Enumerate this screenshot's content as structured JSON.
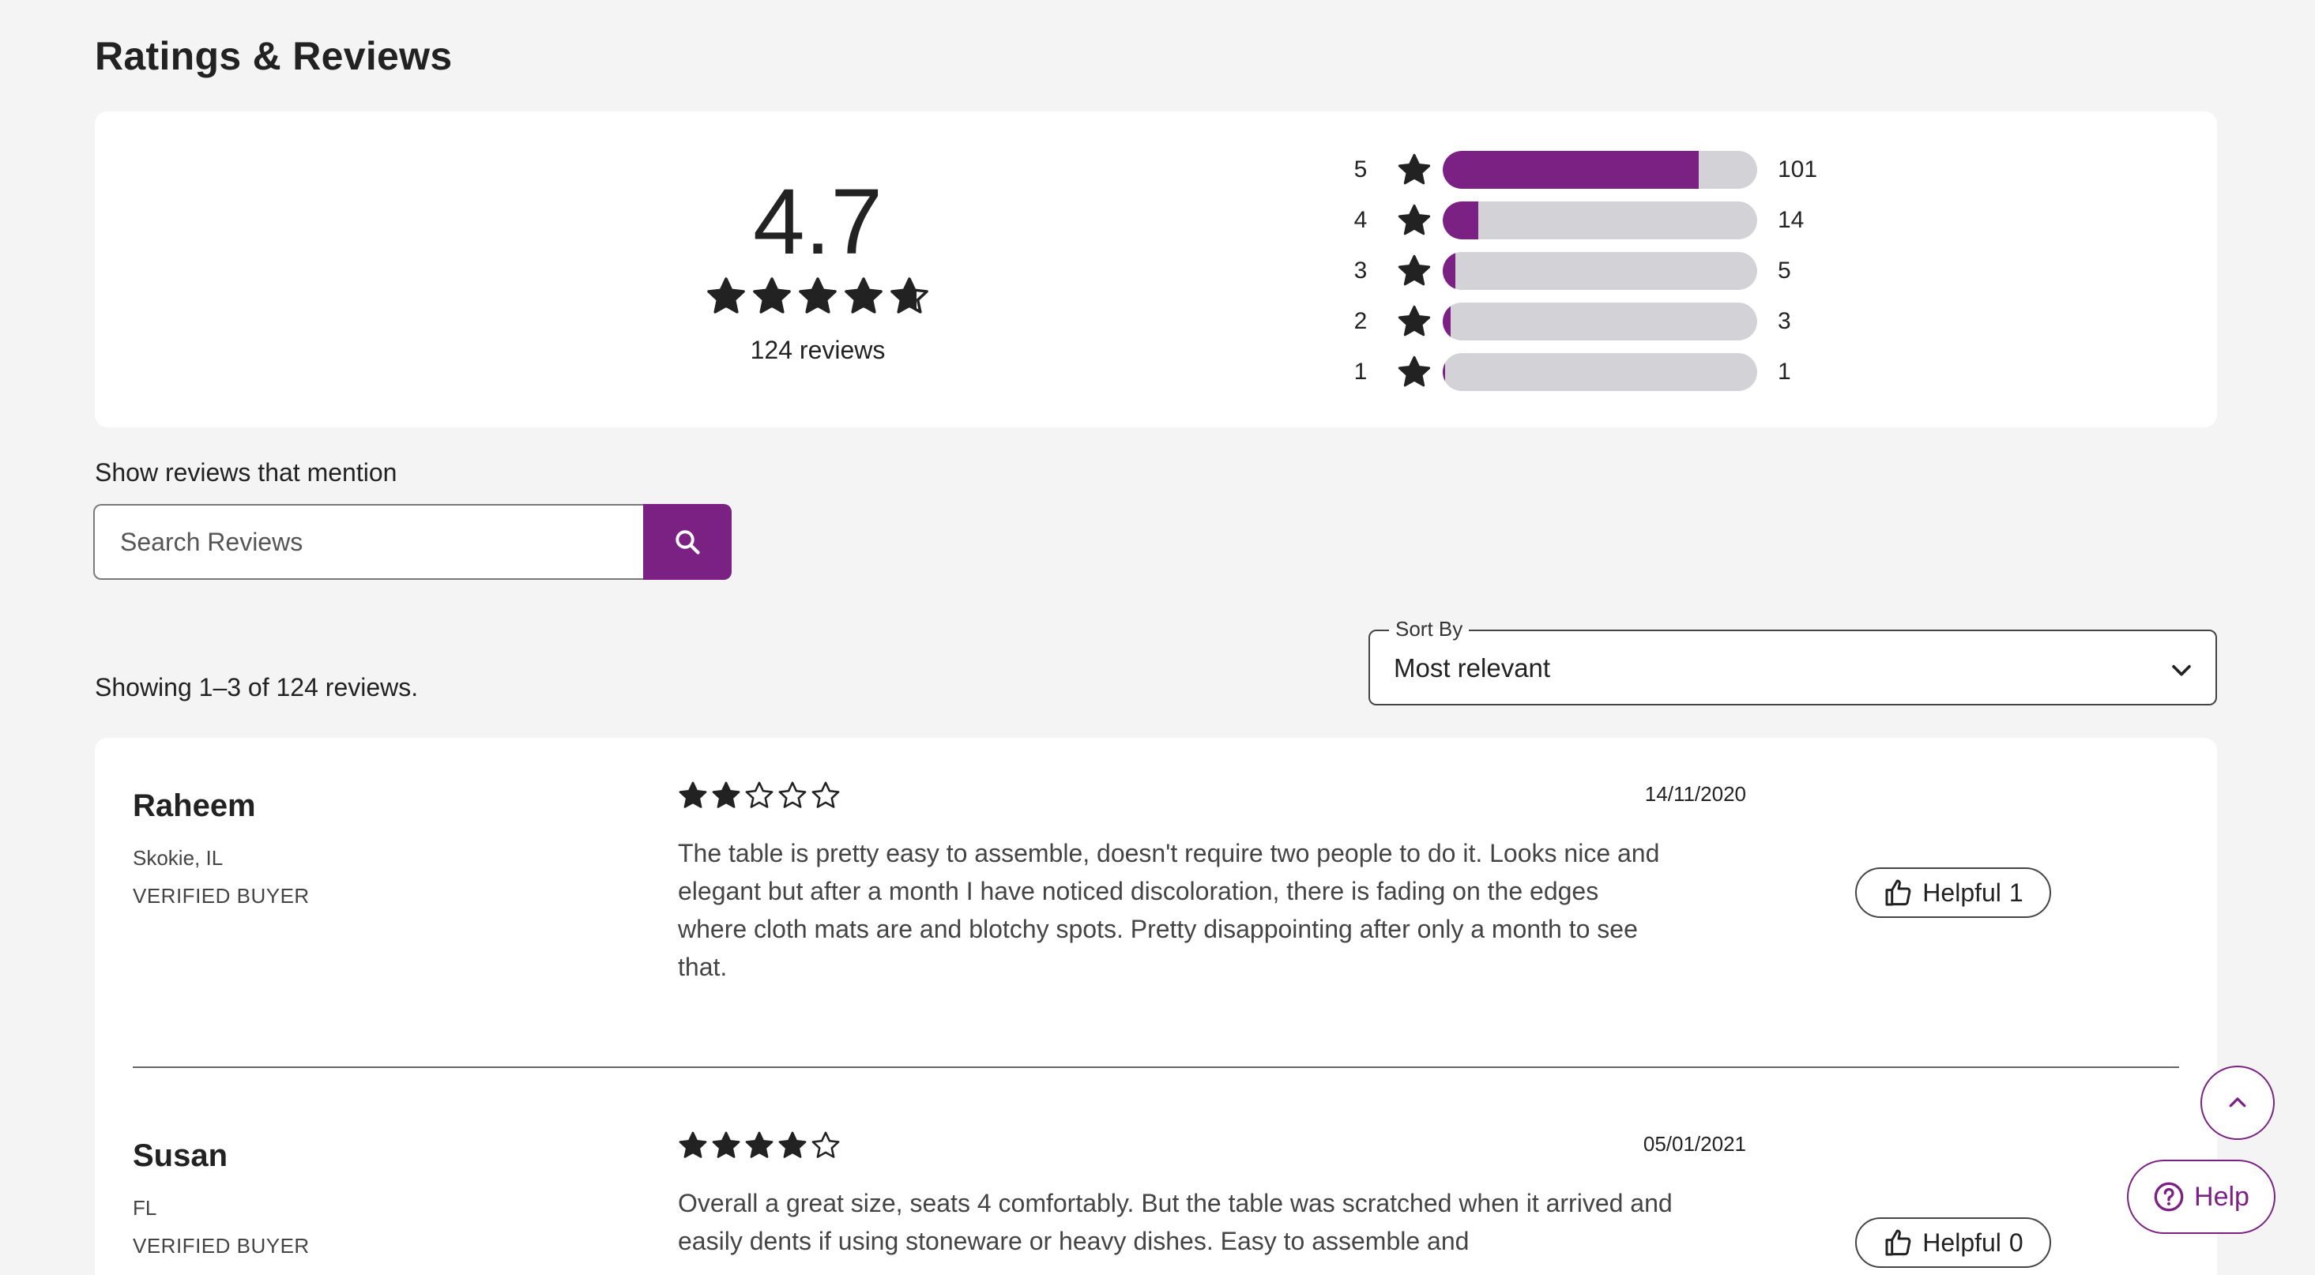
{
  "page_title": "Ratings & Reviews",
  "summary": {
    "average": "4.7",
    "average_stars": 4.7,
    "review_count_label": "124 reviews",
    "distribution": [
      {
        "stars": "5",
        "count": "101",
        "fraction": 0.815
      },
      {
        "stars": "4",
        "count": "14",
        "fraction": 0.113
      },
      {
        "stars": "3",
        "count": "5",
        "fraction": 0.04
      },
      {
        "stars": "2",
        "count": "3",
        "fraction": 0.024
      },
      {
        "stars": "1",
        "count": "1",
        "fraction": 0.008
      }
    ]
  },
  "search": {
    "label": "Show reviews that mention",
    "placeholder": "Search Reviews",
    "button_icon": "search-icon"
  },
  "showing_label": "Showing 1–3 of 124 reviews.",
  "sort": {
    "legend": "Sort By",
    "selected": "Most relevant",
    "icon": "chevron-down-icon"
  },
  "reviews": [
    {
      "name": "Raheem",
      "location": "Skokie, IL",
      "verified": "VERIFIED BUYER",
      "rating": 2,
      "date": "14/11/2020",
      "body": "The table is pretty easy to assemble, doesn't require two people to do it. Looks nice and elegant but after a month I have noticed discoloration, there is fading on the edges where cloth mats are and blotchy spots. Pretty disappointing after only a month to see that.",
      "helpful_label": "Helpful",
      "helpful_count": "1"
    },
    {
      "name": "Susan",
      "location": "FL",
      "verified": "VERIFIED BUYER",
      "rating": 4,
      "date": "05/01/2021",
      "body": "Overall a great size, seats 4 comfortably. But the table was scratched when it arrived and easily dents if using stoneware or heavy dishes. Easy to assemble and",
      "helpful_label": "Helpful",
      "helpful_count": "0"
    }
  ],
  "floating": {
    "scroll_top_icon": "chevron-up-icon",
    "help_label": "Help",
    "help_icon": "question-circle-icon"
  },
  "colors": {
    "accent": "#7b2183",
    "bar_track": "#d3d2d6",
    "star": "#222222",
    "background": "#f4f4f4"
  }
}
